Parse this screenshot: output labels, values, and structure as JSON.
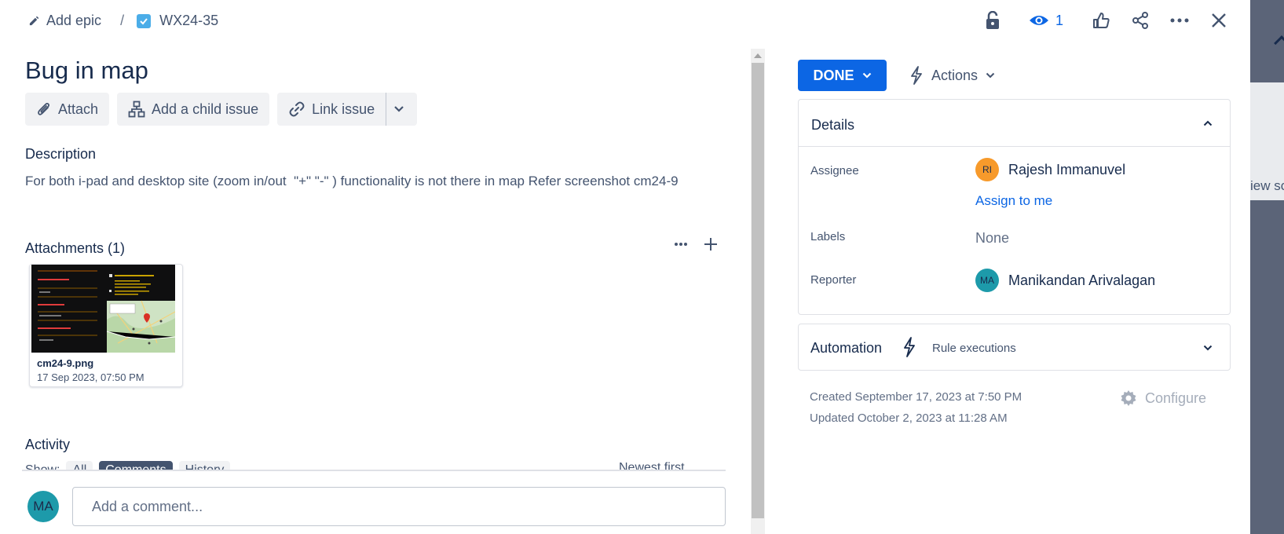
{
  "breadcrumb": {
    "epic": "Add epic",
    "separator": "/",
    "issue_key": "WX24-35"
  },
  "header": {
    "watch_count": "1"
  },
  "issue": {
    "title": "Bug in map"
  },
  "toolbar": {
    "attach": "Attach",
    "add_child": "Add a child issue",
    "link_issue": "Link issue"
  },
  "description": {
    "heading": "Description",
    "text": "For both i-pad and desktop site (zoom in/out  \"+\" \"-\" ) functionality is not there in map Refer screenshot cm24-9"
  },
  "attachments": {
    "heading": "Attachments (1)",
    "items": [
      {
        "name": "cm24-9.png",
        "date": "17 Sep 2023, 07:50 PM"
      }
    ]
  },
  "activity": {
    "heading": "Activity",
    "show_label": "Show:",
    "tabs": [
      "All",
      "Comments",
      "History"
    ],
    "sort": "Newest first"
  },
  "comment": {
    "avatar_initials": "MA",
    "placeholder": "Add a comment..."
  },
  "status": {
    "label": "DONE"
  },
  "actions": {
    "label": "Actions"
  },
  "details": {
    "heading": "Details",
    "assignee": {
      "label": "Assignee",
      "name": "Rajesh Immanuvel",
      "initials": "RI",
      "assign_link": "Assign to me"
    },
    "labels": {
      "label": "Labels",
      "value": "None"
    },
    "reporter": {
      "label": "Reporter",
      "name": "Manikandan Arivalagan",
      "initials": "MA"
    }
  },
  "automation": {
    "heading": "Automation",
    "sub": "Rule executions"
  },
  "meta": {
    "created": "Created September 17, 2023 at 7:50 PM",
    "updated": "Updated October 2, 2023 at 11:28 AM",
    "configure": "Configure"
  },
  "backdrop": {
    "peek_text": "iew sc"
  },
  "colors": {
    "accent": "#0c66e4",
    "assignee_avatar": "#f79a2b",
    "reporter_avatar": "#1d9aaa",
    "backdrop": "#5b6478"
  }
}
